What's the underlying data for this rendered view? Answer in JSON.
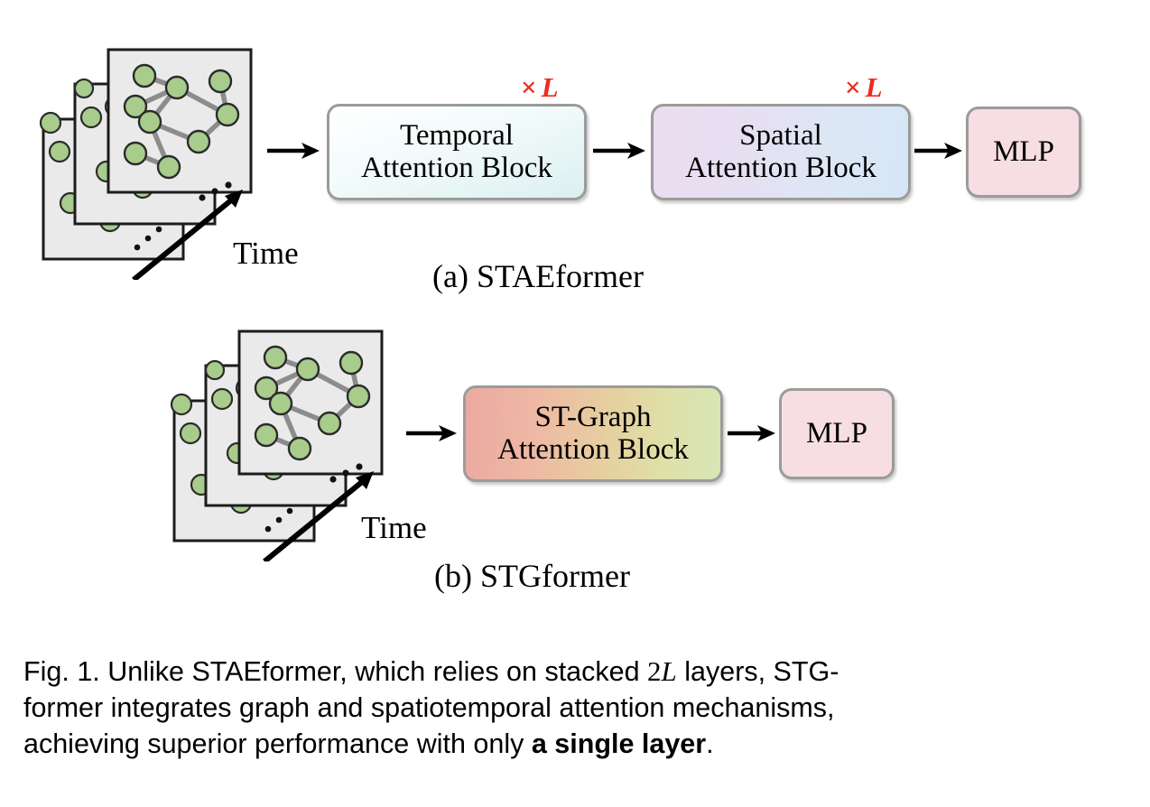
{
  "figure": {
    "caption_label": "Fig. 1.",
    "caption_line1_a": "Fig. 1.  Unlike STAEformer, which relies on stacked ",
    "caption_math_2": "2",
    "caption_math_L": "L",
    "caption_line1_b": " layers, STG-",
    "caption_line2": "former integrates graph and spatiotemporal attention mechanisms,",
    "caption_line3_a": "achieving superior performance with only ",
    "caption_line3_bold": "a single layer",
    "caption_line3_b": "."
  },
  "panel_a": {
    "subcaption": "(a) STAEformer",
    "time_label": "Time",
    "blocks": [
      {
        "name": "temporal-attention-block",
        "line1": "Temporal",
        "line2": "Attention Block",
        "multiplier_symbol": "×",
        "multiplier_value": "L"
      },
      {
        "name": "spatial-attention-block",
        "line1": "Spatial",
        "line2": "Attention Block",
        "multiplier_symbol": "×",
        "multiplier_value": "L"
      },
      {
        "name": "mlp-block",
        "line1": "MLP",
        "line2": ""
      }
    ],
    "arrows": [
      "input-arrow",
      "temporal-to-spatial-arrow",
      "spatial-to-mlp-arrow"
    ]
  },
  "panel_b": {
    "subcaption": "(b) STGformer",
    "time_label": "Time",
    "blocks": [
      {
        "name": "st-graph-attention-block",
        "line1": "ST-Graph",
        "line2": "Attention Block"
      },
      {
        "name": "mlp-block",
        "line1": "MLP",
        "line2": ""
      }
    ],
    "arrows": [
      "input-arrow",
      "stgraph-to-mlp-arrow"
    ]
  },
  "colors": {
    "accent_red": "#ee2b20",
    "node_green": "#a8cc8c",
    "node_stroke": "#2b2b2b",
    "edge_gray": "#8c8c8c",
    "panel_fill": "#eaeaea",
    "panel_stroke": "#1c1c1c",
    "block_border": "#9b9b9b",
    "mlp_fill": "#f6dee2"
  },
  "graph_stack": {
    "label": "spatiotemporal graph snapshots over time",
    "panel_count": 3,
    "nodes_per_panel": 9,
    "ellipsis_dots": 3
  }
}
